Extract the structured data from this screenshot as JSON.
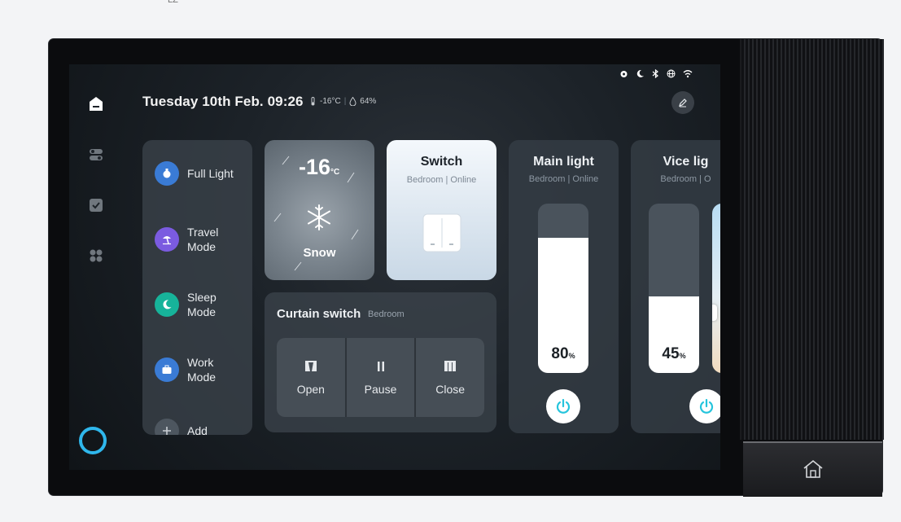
{
  "corner_mark": "LZ",
  "header": {
    "date_time": "Tuesday 10th Feb. 09:26",
    "temperature": "-16°C",
    "humidity": "64%"
  },
  "scenes": [
    {
      "label": "Full Light",
      "icon": "light-bulb-icon",
      "color": "#3a7bd5"
    },
    {
      "label": "Travel Mode",
      "icon": "beach-umbrella-icon",
      "color": "#7b5be0"
    },
    {
      "label": "Sleep Mode",
      "icon": "moon-icon",
      "color": "#17b39a"
    },
    {
      "label": "Work Mode",
      "icon": "briefcase-icon",
      "color": "#3a7bd5"
    },
    {
      "label": "Add",
      "icon": "plus-icon"
    }
  ],
  "weather": {
    "temp": "-16",
    "unit": "°C",
    "condition": "Snow"
  },
  "switch": {
    "title": "Switch",
    "subtitle": "Bedroom | Online"
  },
  "curtain": {
    "title": "Curtain switch",
    "room": "Bedroom",
    "buttons": [
      "Open",
      "Pause",
      "Close"
    ]
  },
  "main_light": {
    "title": "Main light",
    "subtitle": "Bedroom | Online",
    "brightness": 80,
    "value_label": "80",
    "unit": "%"
  },
  "vice_light": {
    "title": "Vice lig",
    "subtitle": "Bedroom | O",
    "brightness": 45,
    "value_label": "45",
    "unit": "%"
  },
  "colors": {
    "accent_power": "#25c4dc",
    "alexa": "#2fb7ec"
  }
}
